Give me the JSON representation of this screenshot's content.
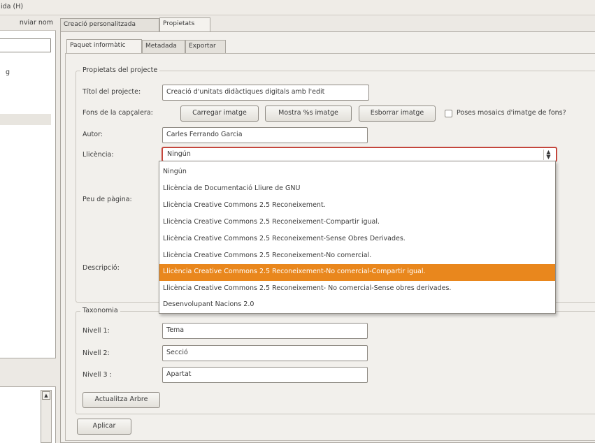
{
  "menubar": {
    "partial_label": "ida (H)"
  },
  "left_panel": {
    "header_partial": "nviar nom",
    "item_partial": "g"
  },
  "tabs": [
    "Creació personalitzada",
    "Propietats"
  ],
  "subtabs": [
    "Paquet informàtic",
    "Metadada",
    "Exportar"
  ],
  "project_properties": {
    "title": "Propietats del projecte",
    "title_label": "Títol del projecte:",
    "title_value": "Creació d'unitats didàctiques digitals amb l'edit",
    "header_bg_label": "Fons de la capçalera:",
    "btn_load_image": "Carregar imatge",
    "btn_show_image": "Mostra %s imatge",
    "btn_delete_image": "Esborrar imatge",
    "mosaic_checkbox": "Poses mosaics d'imatge de fons?",
    "author_label": "Autor:",
    "author_value": "Carles Ferrando Garcia",
    "license_label": "Llicència:",
    "license_value": "Ningún",
    "footer_label": "Peu de pàgina:",
    "description_label": "Descripció:"
  },
  "license_options": [
    "Ningún",
    "Llicència de Documentació Lliure de GNU",
    "Llicència Creative Commons 2.5 Reconeixement.",
    "Llicència Creative Commons 2.5 Reconeixement-Compartir igual.",
    "Llicència Creative Commons 2.5 Reconeixement-Sense Obres Derivades.",
    "Llicència Creative Commons 2.5 Reconeixement-No comercial.",
    "Llicència Creative Commons 2.5 Reconeixement-No comercial-Compartir igual.",
    "Llicència Creative Commons 2.5 Reconeixement- No comercial-Sense obres derivades.",
    "Desenvolupant Nacions 2.0"
  ],
  "selected_option_index": 6,
  "taxonomy": {
    "title": "Taxonomia",
    "level1_label": "Nivell 1:",
    "level1_value": "Tema",
    "level2_label": "Nivell 2:",
    "level2_value": "Secció",
    "level3_label": "Nivell 3 :",
    "level3_value": "Apartat",
    "update_tree": "Actualitza Arbre"
  },
  "apply_button": "Aplicar",
  "colors": {
    "highlight": "#e9871d",
    "combo_border": "#c4463c"
  }
}
